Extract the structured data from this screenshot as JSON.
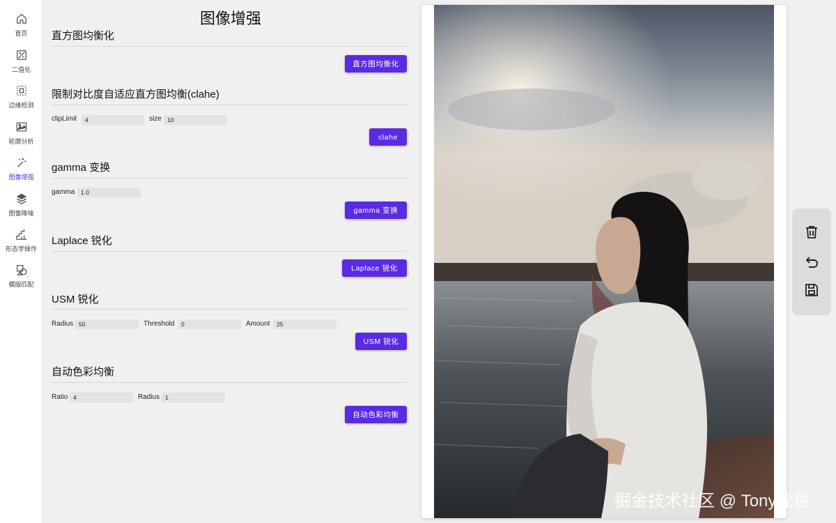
{
  "sidebar": {
    "items": [
      {
        "label": "首页",
        "icon": "home-icon"
      },
      {
        "label": "二值化",
        "icon": "binarize-icon"
      },
      {
        "label": "边缘检测",
        "icon": "edge-detect-icon"
      },
      {
        "label": "轮廓分析",
        "icon": "contour-icon"
      },
      {
        "label": "图像增强",
        "icon": "magic-wand-icon",
        "active": true
      },
      {
        "label": "图像降噪",
        "icon": "layers-icon"
      },
      {
        "label": "形态学操作",
        "icon": "steps-icon"
      },
      {
        "label": "模版匹配",
        "icon": "shapes-icon"
      }
    ]
  },
  "main": {
    "title": "图像增强",
    "hist": {
      "title": "直方图均衡化",
      "button": "直方图均衡化"
    },
    "clahe": {
      "title": "限制对比度自适应直方图均衡(clahe)",
      "cliplimit_label": "clipLimit",
      "cliplimit_value": "4",
      "size_label": "size",
      "size_value": "10",
      "button": "clahe"
    },
    "gamma": {
      "title": "gamma 变换",
      "gamma_label": "gamma",
      "gamma_value": "1.0",
      "button": "gamma 变换"
    },
    "laplace": {
      "title": "Laplace 锐化",
      "button": "Laplace 锐化"
    },
    "usm": {
      "title": "USM 锐化",
      "radius_label": "Radius",
      "radius_value": "50",
      "threshold_label": "Threshold",
      "threshold_value": "0",
      "amount_label": "Amount",
      "amount_value": "25",
      "button": "USM 锐化"
    },
    "ace": {
      "title": "自动色彩均衡",
      "ratio_label": "Ratio",
      "ratio_value": "4",
      "radius_label": "Radius",
      "radius_value": "1",
      "button": "自动色彩均衡"
    }
  },
  "toolbar": {
    "tools": [
      "trash-icon",
      "undo-icon",
      "save-icon"
    ]
  },
  "watermark": "掘金技术社区 @ Tony沈哲",
  "colors": {
    "accent": "#5b2be3",
    "sidebar_active": "#5b2ee0",
    "background": "#f0f0f0"
  }
}
